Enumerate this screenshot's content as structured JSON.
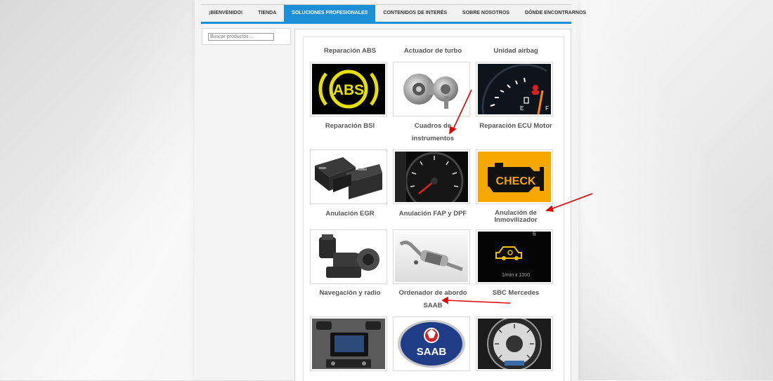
{
  "nav": {
    "tabs": [
      {
        "label": "¡BIENVENIDO!"
      },
      {
        "label": "TIENDA"
      },
      {
        "label": "SOLUCIONES PROFESIONALES"
      },
      {
        "label": "CONTENIDOS DE INTERÉS"
      },
      {
        "label": "SOBRE NOSOTROS"
      },
      {
        "label": "DÓNDE ENCONTRARNOS"
      }
    ],
    "active_index": 2
  },
  "search": {
    "placeholder": "Buscar productos ..."
  },
  "colors": {
    "accent": "#1d8fd6",
    "annotation": "#e00000"
  },
  "products": [
    {
      "title": "Reparación ABS",
      "icon": "abs-warning-icon"
    },
    {
      "title": "Actuador de turbo",
      "icon": "turbocharger-icon"
    },
    {
      "title": "Unidad airbag",
      "icon": "airbag-dashboard-icon"
    },
    {
      "title": "Reparación BSI",
      "icon": "bsi-module-icon"
    },
    {
      "title_line1": "Cuadros de",
      "title_line2": "instrumentos",
      "icon": "speedometer-icon"
    },
    {
      "title": "Reparación ECU Motor",
      "icon": "check-engine-icon"
    },
    {
      "title": "Anulación EGR",
      "icon": "egr-valve-icon"
    },
    {
      "title": "Anulación FAP y DPF",
      "icon": "dpf-filter-icon"
    },
    {
      "title_line1": "Anulación de",
      "title_line2": "Inmovilizador",
      "icon": "immobilizer-light-icon"
    },
    {
      "title": "Navegación y radio",
      "icon": "car-radio-icon"
    },
    {
      "title_line1": "Ordenador  de abordo",
      "title_line2": "SAAB",
      "icon": "saab-logo-icon"
    },
    {
      "title": "SBC Mercedes",
      "icon": "mercedes-cluster-icon"
    }
  ],
  "dashboard_texts": {
    "abs": "ABS",
    "check": "CHECK",
    "saab": "SAAB",
    "fuel_e": "E",
    "fuel_f": "F",
    "rpm": "1/min x 1000"
  }
}
